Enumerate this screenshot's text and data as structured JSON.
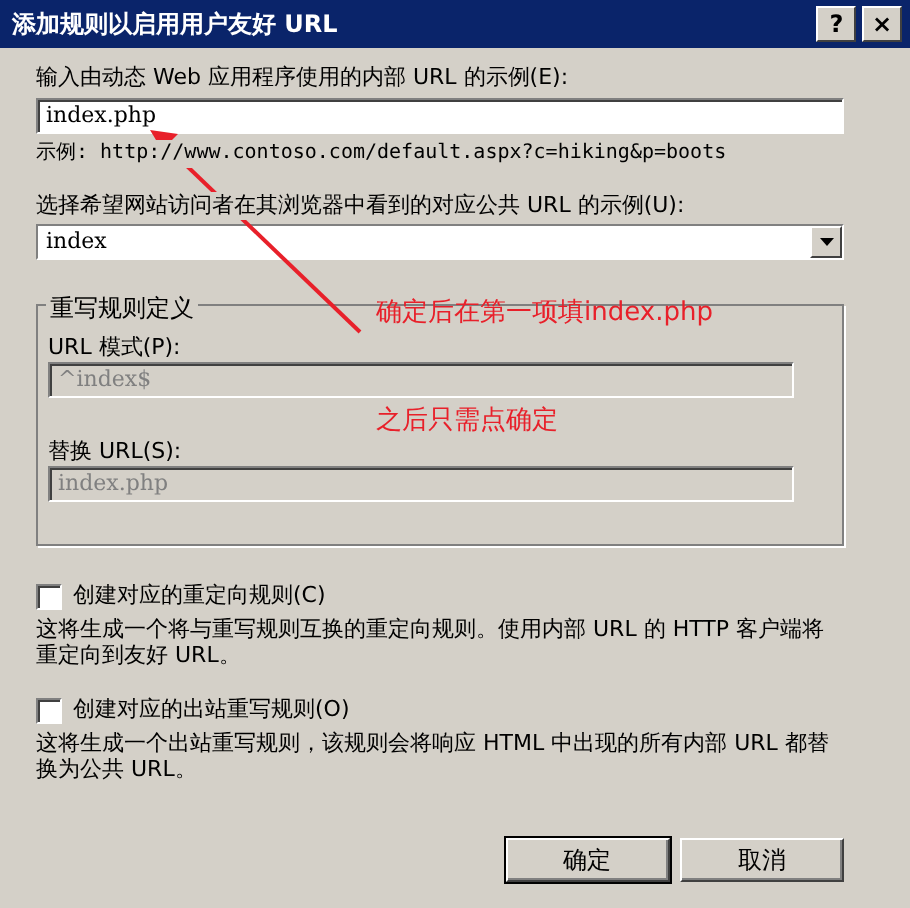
{
  "window": {
    "title": "添加规则以启用用户友好 URL",
    "controls": [
      "?",
      "×"
    ]
  },
  "internal_url": {
    "label": "输入由动态 Web 应用程序使用的内部 URL 的示例(E):",
    "value": "index.php"
  },
  "example": "示例: http://www.contoso.com/default.aspx?c=hiking&p=boots",
  "public_url": {
    "label": "选择希望网站访问者在其浏览器中看到的对应公共 URL 的示例(U):",
    "value": "index"
  },
  "rewrite_group": {
    "title": "重写规则定义",
    "fields": [
      {
        "label": "URL 模式(P):",
        "value": "^index$",
        "disabled": true
      },
      {
        "label": "替换 URL(S):",
        "value": "index.php",
        "disabled": true
      }
    ]
  },
  "options": [
    {
      "label": "创建对应的重定向规则(C)",
      "checked": false,
      "description": "这将生成一个将与重写规则互换的重定向规则。使用内部 URL 的 HTTP 客户端将重定向到友好 URL。"
    },
    {
      "label": "创建对应的出站重写规则(O)",
      "checked": false,
      "description": "这将生成一个出站重写规则，该规则会将响应 HTML 中出现的所有内部 URL 都替换为公共 URL。"
    }
  ],
  "buttons": [
    {
      "label": "确定"
    },
    {
      "label": "取消"
    }
  ],
  "annotations": [
    {
      "text": "确定后在第一项填index.php"
    },
    {
      "text": "之后只需点确定"
    }
  ]
}
